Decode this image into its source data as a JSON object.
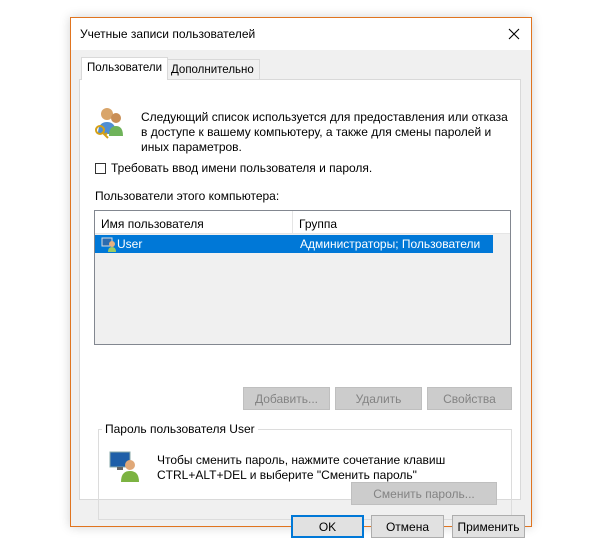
{
  "window": {
    "title": "Учетные записи пользователей"
  },
  "tabs": [
    {
      "label": "Пользователи",
      "active": true
    },
    {
      "label": "Дополнительно",
      "active": false
    }
  ],
  "intro": {
    "line1": "Следующий список используется для предоставления или отказа",
    "line2": "в доступе к вашему компьютеру, а также для смены паролей и",
    "line3": "иных параметров."
  },
  "require_login": {
    "label": "Требовать ввод имени пользователя и пароля.",
    "checked": false
  },
  "users_list": {
    "caption": "Пользователи этого компьютера:",
    "columns": [
      "Имя пользователя",
      "Группа"
    ],
    "rows": [
      {
        "name": "User",
        "group": "Администраторы; Пользователи",
        "selected": true
      }
    ]
  },
  "list_buttons": {
    "add": "Добавить...",
    "remove": "Удалить",
    "properties": "Свойства"
  },
  "password_group": {
    "title": "Пароль пользователя User",
    "line1": "Чтобы сменить пароль, нажмите сочетание клавиш",
    "line2": "CTRL+ALT+DEL и выберите \"Сменить пароль\"",
    "change_button": "Сменить пароль..."
  },
  "dialog_buttons": {
    "ok": "OK",
    "cancel": "Отмена",
    "apply": "Применить"
  },
  "colors": {
    "accent_border": "#e0741f",
    "selection": "#0078d7",
    "default_button_border": "#0078d7"
  },
  "icons": [
    "close-icon",
    "users-keys-icon",
    "user-row-icon",
    "user-monitor-icon"
  ]
}
